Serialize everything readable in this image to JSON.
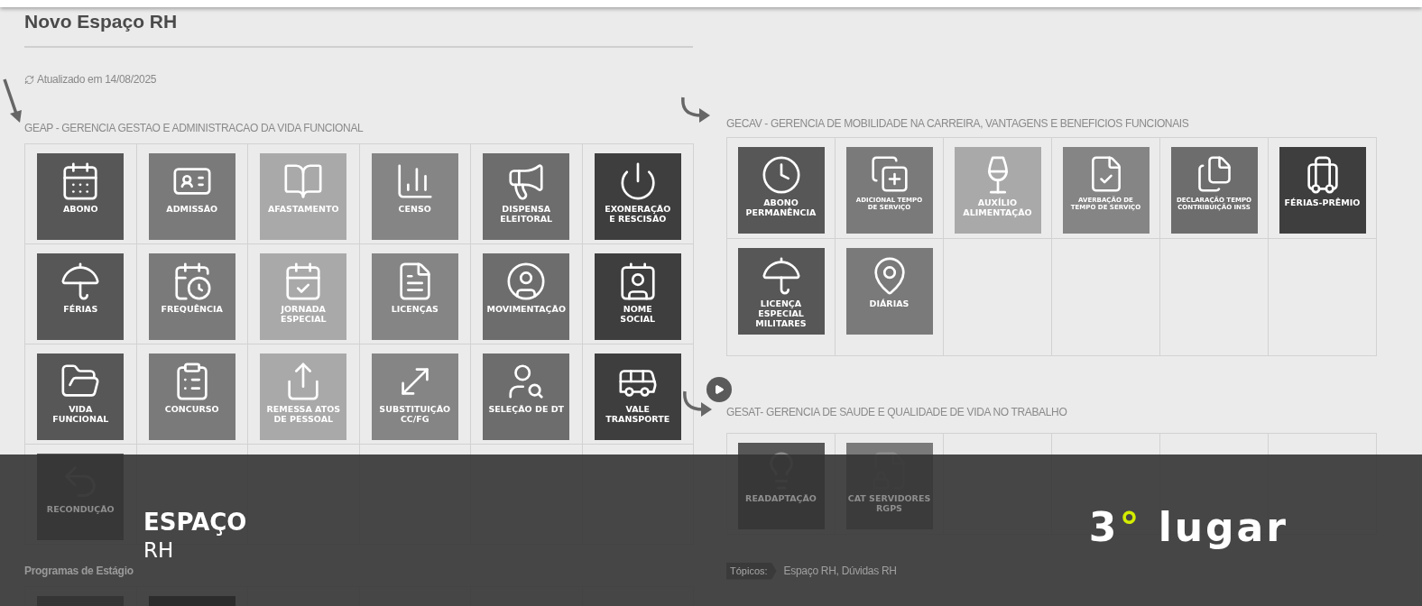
{
  "page": {
    "title": "Novo Espaço RH",
    "updated": "Atualizado em 14/08/2025"
  },
  "sections": [
    {
      "heading": "GEAP - GERENCIA GESTAO E ADMINISTRACAO DA VIDA FUNCIONAL",
      "tiles": [
        {
          "label": "ABONO",
          "color": "#575757"
        },
        {
          "label": "ADMISSÃO",
          "color": "#7a7a7a"
        },
        {
          "label": "AFASTAMENTO",
          "color": "#a9a9a9"
        },
        {
          "label": "CENSO",
          "color": "#858585"
        },
        {
          "label": "DISPENSA\nELEITORAL",
          "color": "#6d6d6d"
        },
        {
          "label": "EXONERAÇÃO\nE RESCISÃO",
          "color": "#3e3e3e"
        },
        {
          "label": "FÉRIAS",
          "color": "#575757"
        },
        {
          "label": "FREQUÊNCIA",
          "color": "#7a7a7a"
        },
        {
          "label": "JORNADA\nESPECIAL",
          "color": "#a9a9a9"
        },
        {
          "label": "LICENÇAS",
          "color": "#858585"
        },
        {
          "label": "MOVIMENTAÇÃO",
          "color": "#6d6d6d"
        },
        {
          "label": "NOME\nSOCIAL",
          "color": "#3e3e3e"
        },
        {
          "label": "VIDA\nFUNCIONAL",
          "color": "#575757"
        },
        {
          "label": "CONCURSO",
          "color": "#7a7a7a"
        },
        {
          "label": "REMESSA ATOS\nDE PESSOAL",
          "color": "#a9a9a9"
        },
        {
          "label": "SUBSTITUIÇÃO\nCC/FG",
          "color": "#858585"
        },
        {
          "label": "SELEÇÃO DE DT",
          "color": "#6d6d6d"
        },
        {
          "label": "VALE\nTRANSPORTE",
          "color": "#3e3e3e"
        },
        {
          "label": "RECONDUÇÃO",
          "color": "#575757"
        }
      ]
    },
    {
      "heading": "GECAV - GERENCIA DE MOBILIDADE NA CARREIRA, VANTAGENS E BENEFICIOS FUNCIONAIS",
      "tiles": [
        {
          "label": "ABONO\nPERMANÊNCIA",
          "color": "#575757"
        },
        {
          "label": "ADICIONAL TEMPO\nDE SERVIÇO",
          "color": "#7a7a7a"
        },
        {
          "label": "AUXÍLIO\nALIMENTAÇÃO",
          "color": "#a9a9a9"
        },
        {
          "label": "AVERBAÇÃO DE\nTEMPO DE SERVIÇO",
          "color": "#858585"
        },
        {
          "label": "DECLARAÇÃO TEMPO\nCONTRIBUIÇÃO INSS",
          "color": "#6d6d6d"
        },
        {
          "label": "FÉRIAS-PRÊMIO",
          "color": "#3e3e3e"
        },
        {
          "label": "LICENÇA ESPECIAL\nMILITARES",
          "color": "#575757"
        },
        {
          "label": "DIÁRIAS",
          "color": "#7a7a7a"
        }
      ]
    },
    {
      "heading": "GESAT- GERENCIA DE SAUDE E QUALIDADE DE VIDA NO TRABALHO",
      "tiles": [
        {
          "label": "READAPTAÇÃO",
          "color": "#575757"
        },
        {
          "label": "CAT SERVIDORES\nRGPS",
          "color": "#7a7a7a"
        }
      ]
    },
    {
      "heading": "Programas de Estágio",
      "tiles": [
        {
          "color": "#353535"
        },
        {
          "color": "#2c2c2c"
        }
      ]
    }
  ],
  "topics": {
    "tag": "Tópicos:",
    "links": "Espaço RH, Dúvidas RH"
  },
  "overlay": {
    "title": "ESPAÇO",
    "subtitle": "RH",
    "rank": {
      "number": "3",
      "symbol": "°",
      "word": "lugar"
    }
  }
}
